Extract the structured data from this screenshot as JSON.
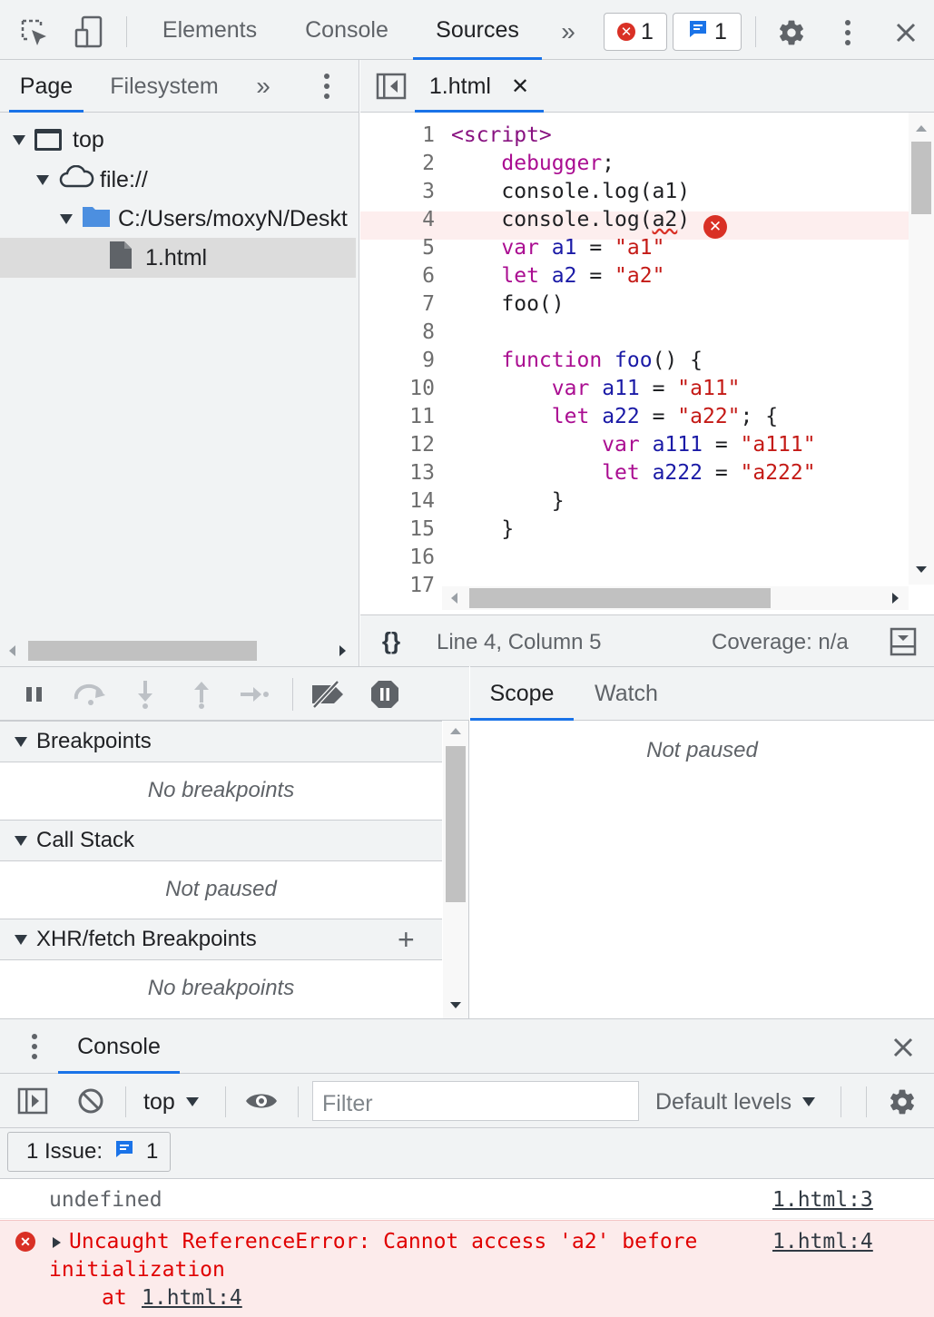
{
  "toolbar": {
    "tabs": [
      "Elements",
      "Console",
      "Sources"
    ],
    "active_tab": "Sources",
    "error_count": "1",
    "issue_count": "1"
  },
  "navigator": {
    "tabs": [
      "Page",
      "Filesystem"
    ],
    "tree": {
      "top": "top",
      "origin": "file://",
      "folder": "C:/Users/moxyN/Deskt",
      "file": "1.html"
    }
  },
  "editor": {
    "file_tab": "1.html",
    "line_numbers": [
      "1",
      "2",
      "3",
      "4",
      "5",
      "6",
      "7",
      "8",
      "9",
      "10",
      "11",
      "12",
      "13",
      "14",
      "15",
      "16",
      "17"
    ],
    "status_position": "Line 4, Column 5",
    "status_coverage": "Coverage: n/a"
  },
  "debugger": {
    "sections": {
      "breakpoints": "Breakpoints",
      "call_stack": "Call Stack",
      "xhr": "XHR/fetch Breakpoints"
    },
    "empty": {
      "no_breakpoints": "No breakpoints",
      "not_paused": "Not paused",
      "no_xhr_breakpoints": "No breakpoints"
    }
  },
  "scope": {
    "tabs": [
      "Scope",
      "Watch"
    ],
    "empty": "Not paused"
  },
  "drawer": {
    "tab": "Console",
    "context": "top",
    "filter_placeholder": "Filter",
    "levels": "Default levels",
    "issues_label": "1 Issue:",
    "issues_count": "1",
    "messages": [
      {
        "text": "undefined",
        "source": "1.html:3"
      },
      {
        "text": "Uncaught ReferenceError: Cannot access 'a2' before",
        "text2": "initialization",
        "at": "at",
        "at_link": "1.html:4",
        "source": "1.html:4"
      }
    ]
  },
  "colors": {
    "accent": "#1a73e8",
    "error": "#d93025",
    "error_bg": "#fcebeb"
  }
}
